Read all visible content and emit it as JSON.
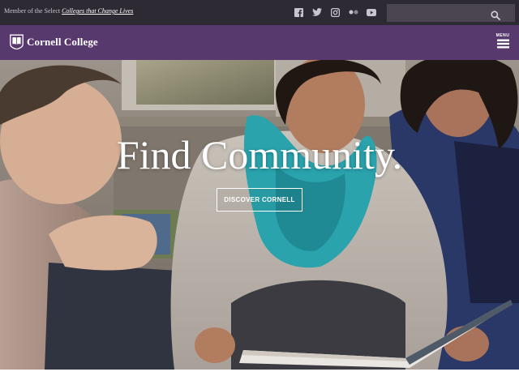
{
  "topbar": {
    "member_prefix": "Member of the Select",
    "member_link": "Colleges that Change Lives",
    "social": [
      {
        "icon": "facebook-icon"
      },
      {
        "icon": "twitter-icon"
      },
      {
        "icon": "instagram-icon"
      },
      {
        "icon": "flickr-icon"
      },
      {
        "icon": "youtube-icon"
      }
    ],
    "search": {
      "placeholder": "",
      "value": ""
    },
    "search_icon": "search-icon"
  },
  "header": {
    "logo_text": "Cornell College",
    "logo_icon": "cornell-seal-icon",
    "menu_label": "MENU",
    "menu_icon": "hamburger-icon"
  },
  "hero": {
    "title": "Find Community.",
    "cta_label": "DISCOVER CORNELL"
  },
  "colors": {
    "topbar_bg": "#2e2a33",
    "header_purple": "#58396e",
    "scarf_teal": "#2aa3ad",
    "text_white": "#ffffff"
  }
}
